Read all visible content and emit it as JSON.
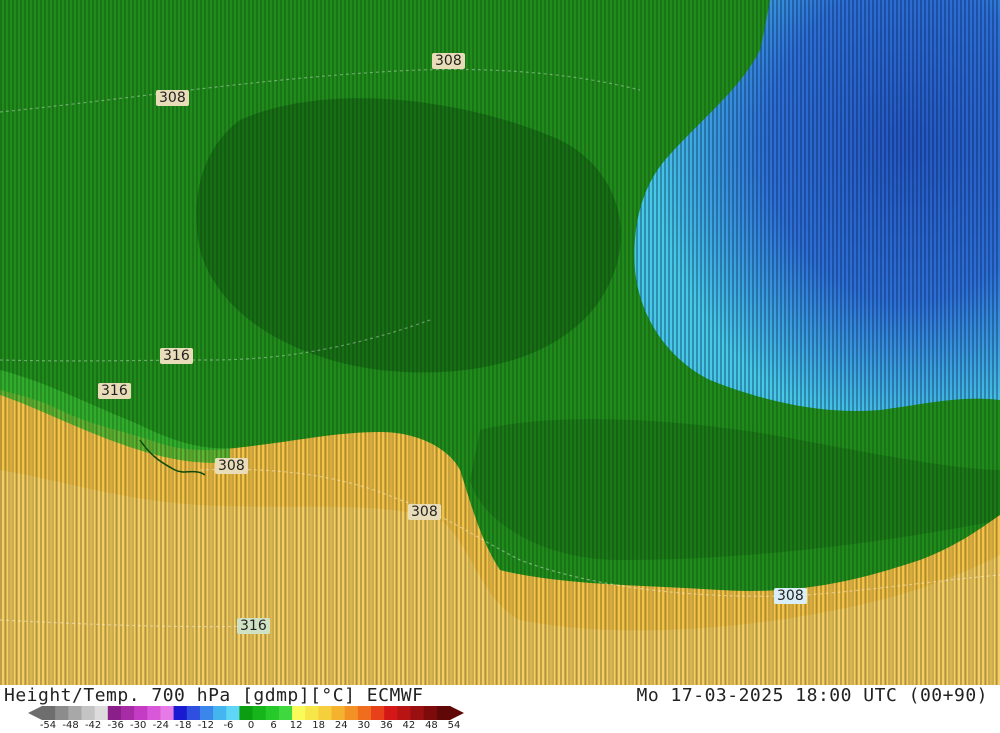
{
  "map": {
    "contour_labels": [
      {
        "id": "c1",
        "text": "308",
        "style": "warm"
      },
      {
        "id": "c2",
        "text": "308",
        "style": "warm"
      },
      {
        "id": "c3",
        "text": "316",
        "style": "warm"
      },
      {
        "id": "c4",
        "text": "316",
        "style": "warm"
      },
      {
        "id": "c5",
        "text": "308",
        "style": "warm"
      },
      {
        "id": "c6",
        "text": "308",
        "style": "warm"
      },
      {
        "id": "c7",
        "text": "308",
        "style": "cool"
      },
      {
        "id": "c8",
        "text": "316",
        "style": "green"
      }
    ],
    "colors": {
      "warm_zone": "#f3c448",
      "warm_zone_light": "#f6d978",
      "green_zone": "#1f8c1c",
      "green_dark": "#176f15",
      "cyan_zone": "#45c9e6",
      "blue_zone": "#2c6fd6",
      "blue_deep": "#2457c2"
    }
  },
  "footer": {
    "title_left": "Height/Temp. 700 hPa [gdmp][°C] ECMWF",
    "title_right": "Mo 17-03-2025 18:00 UTC (00+90)"
  },
  "legend": {
    "ticks": [
      "-54",
      "-48",
      "-42",
      "-36",
      "-30",
      "-24",
      "-18",
      "-12",
      "-6",
      "0",
      "6",
      "12",
      "18",
      "24",
      "30",
      "36",
      "42",
      "48",
      "54"
    ],
    "colors": [
      "#6e6e6e",
      "#8c8c8c",
      "#a8a8a8",
      "#c4c4c4",
      "#dcdcdc",
      "#8a1f8a",
      "#a52ca5",
      "#c43cc4",
      "#d957d9",
      "#e67ae6",
      "#1a1ad1",
      "#2f4fe0",
      "#3b86eb",
      "#45b5f0",
      "#5fd6f5",
      "#0b9e13",
      "#16b51c",
      "#25c92a",
      "#3fd93f",
      "#fafa5a",
      "#f7e64a",
      "#f5cf3c",
      "#f5b22e",
      "#f29224",
      "#ef6d1c",
      "#e8401a",
      "#d41818",
      "#b81414",
      "#9a0f0f",
      "#7e0b0b",
      "#600707"
    ]
  }
}
